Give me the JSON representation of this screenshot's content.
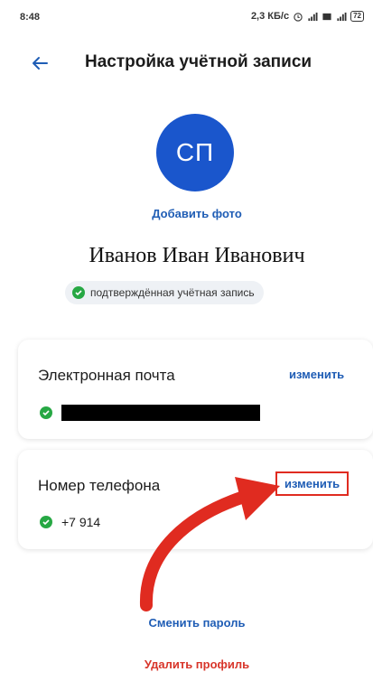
{
  "status_bar": {
    "time": "8:48",
    "network_speed": "2,3 КБ/с",
    "battery": "72"
  },
  "header": {
    "title": "Настройка учётной записи"
  },
  "profile": {
    "initials": "СП",
    "add_photo": "Добавить фото",
    "full_name": "Иванов Иван Иванович",
    "verified_label": "подтверждённая учётная запись"
  },
  "email_card": {
    "label": "Электронная почта",
    "edit": "изменить"
  },
  "phone_card": {
    "label": "Номер телефона",
    "edit": "изменить",
    "value": "+7 914"
  },
  "actions": {
    "change_password": "Сменить пароль",
    "delete_profile": "Удалить профиль"
  },
  "colors": {
    "accent": "#1f5db5",
    "avatar_bg": "#1a56cc",
    "verified": "#27a844",
    "danger": "#d8352a",
    "annotation": "#e02b20"
  }
}
